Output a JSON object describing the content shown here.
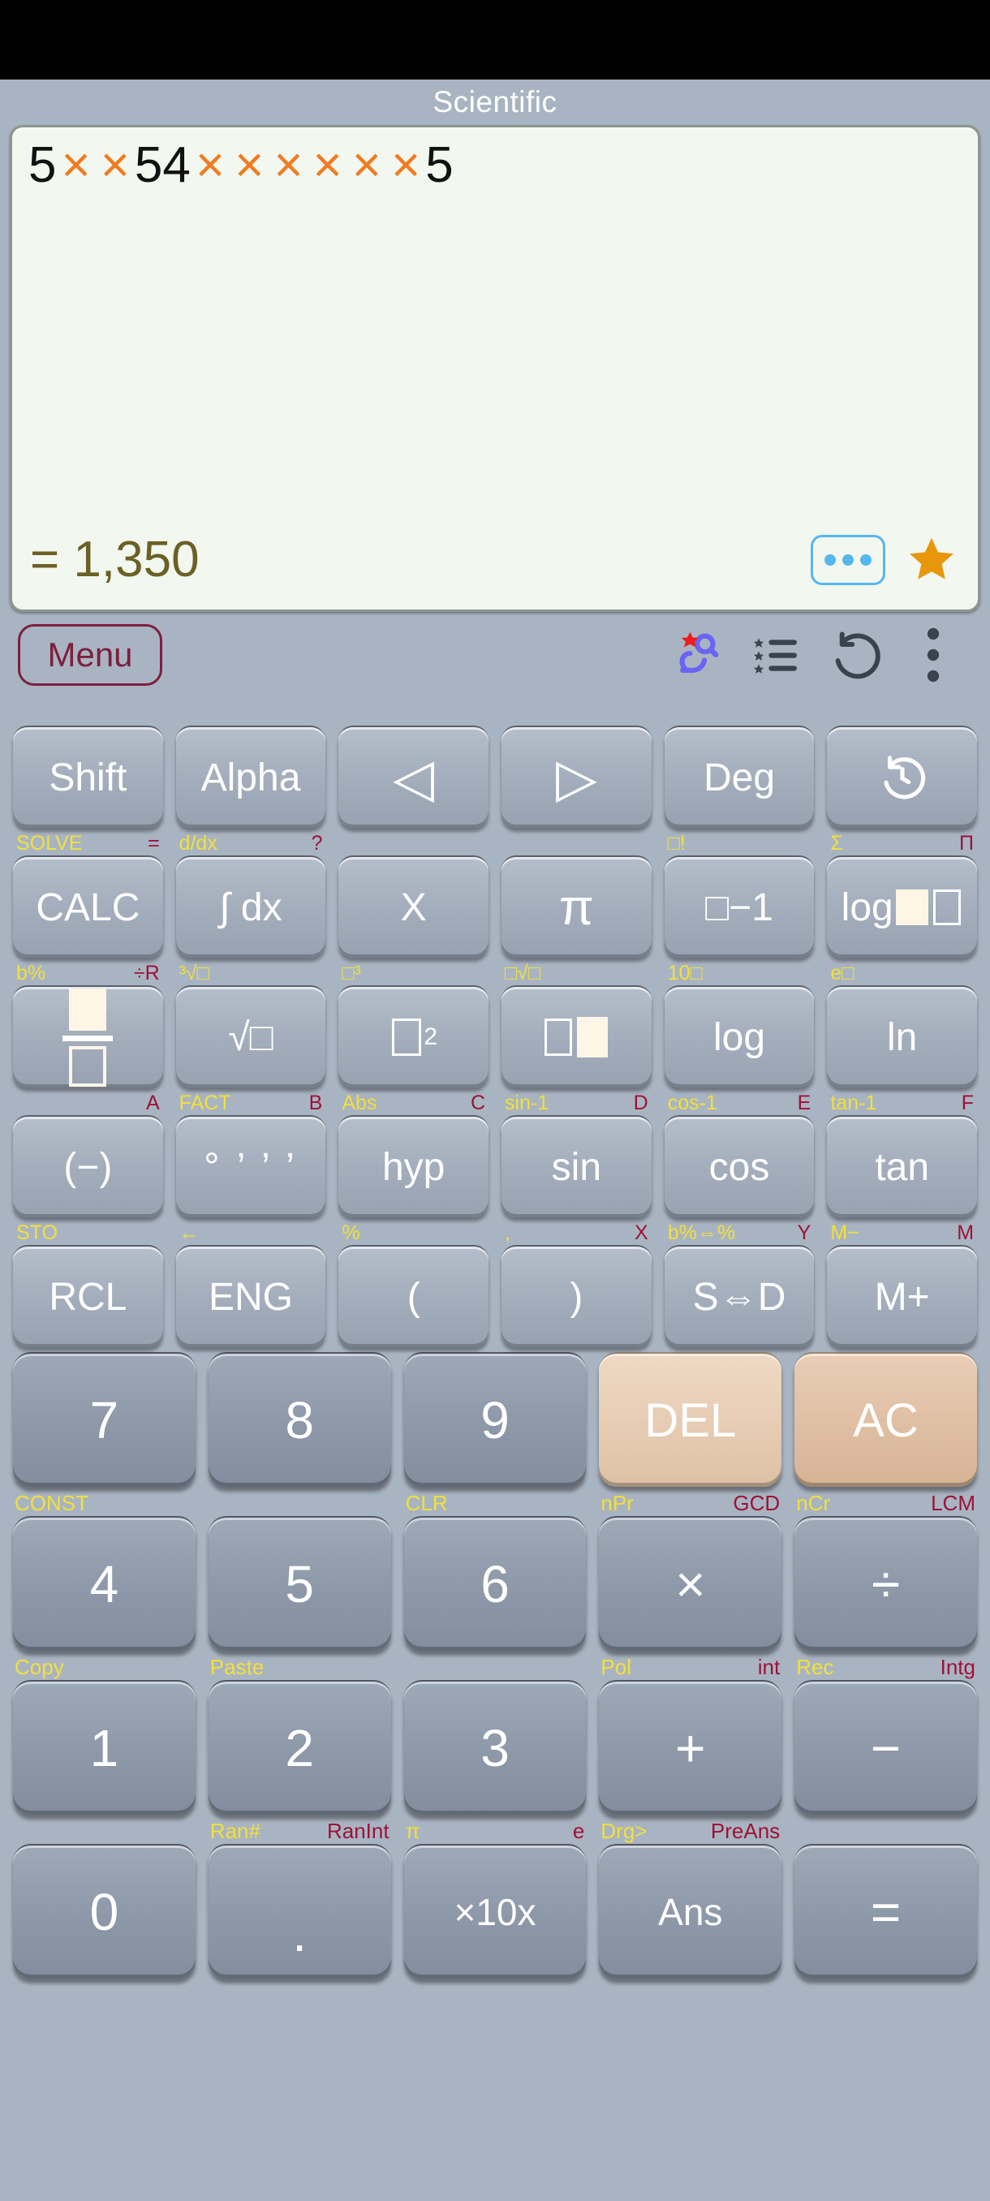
{
  "app": {
    "title": "Scientific"
  },
  "display": {
    "expression_tokens": [
      {
        "t": "5",
        "k": "num"
      },
      {
        "t": "×",
        "k": "op"
      },
      {
        "t": "×",
        "k": "op"
      },
      {
        "t": "54",
        "k": "num"
      },
      {
        "t": "×",
        "k": "op"
      },
      {
        "t": "×",
        "k": "op"
      },
      {
        "t": "×",
        "k": "op"
      },
      {
        "t": "×",
        "k": "op"
      },
      {
        "t": "×",
        "k": "op"
      },
      {
        "t": "×",
        "k": "op"
      },
      {
        "t": "5",
        "k": "num"
      }
    ],
    "expression_text": "5 × × 54 × × × × × × 5",
    "result": "= 1,350",
    "more_button": "…",
    "favorite_icon": "star-icon",
    "colors": {
      "screen_bg": "#f2f7ef",
      "operator": "#f07c21",
      "result_text": "#6b6025",
      "more_border": "#56b7ee",
      "star": "#e8960c"
    }
  },
  "toolbar": {
    "menu_label": "Menu",
    "icons": [
      {
        "name": "search-history-icon"
      },
      {
        "name": "favorites-list-icon"
      },
      {
        "name": "undo-icon"
      },
      {
        "name": "overflow-menu-icon"
      }
    ],
    "menu_color": "#7d1f3d"
  },
  "function_rows": [
    {
      "hints": [
        {
          "shift": "",
          "alpha": ""
        },
        {
          "shift": "",
          "alpha": ""
        },
        {
          "shift": "",
          "alpha": ""
        },
        {
          "shift": "",
          "alpha": ""
        },
        {
          "shift": "",
          "alpha": ""
        },
        {
          "shift": "",
          "alpha": ""
        }
      ],
      "keys": [
        {
          "label": "Shift",
          "name": "shift"
        },
        {
          "label": "Alpha",
          "name": "alpha"
        },
        {
          "label": "◁",
          "name": "arrow-left"
        },
        {
          "label": "▷",
          "name": "arrow-right"
        },
        {
          "label": "Deg",
          "name": "deg"
        },
        {
          "label": "",
          "name": "history",
          "icon": "history-icon"
        }
      ]
    },
    {
      "hints": [
        {
          "shift": "SOLVE",
          "alpha": "="
        },
        {
          "shift": "d/dx",
          "alpha": "?"
        },
        {
          "shift": "",
          "alpha": ""
        },
        {
          "shift": "",
          "alpha": ""
        },
        {
          "shift": "□!",
          "alpha": ""
        },
        {
          "shift": "Σ",
          "alpha": "Π"
        }
      ],
      "keys": [
        {
          "label": "CALC",
          "name": "calc"
        },
        {
          "label": "∫ dx",
          "name": "integral"
        },
        {
          "label": "X",
          "name": "variable-x"
        },
        {
          "label": "π",
          "name": "pi"
        },
        {
          "label": "□−1",
          "name": "reciprocal",
          "icon": "box-inverse"
        },
        {
          "label": "log□□",
          "name": "log-base",
          "icon": "log-base"
        }
      ]
    },
    {
      "hints": [
        {
          "shift": "b%",
          "alpha": "÷R"
        },
        {
          "shift": "³√□",
          "alpha": ""
        },
        {
          "shift": "□³",
          "alpha": ""
        },
        {
          "shift": "□√□",
          "alpha": ""
        },
        {
          "shift": "10□",
          "alpha": ""
        },
        {
          "shift": "e□",
          "alpha": ""
        }
      ],
      "keys": [
        {
          "label": "□/□",
          "name": "fraction",
          "icon": "fraction"
        },
        {
          "label": "√□",
          "name": "square-root",
          "icon": "sqrt"
        },
        {
          "label": "□²",
          "name": "square",
          "icon": "square"
        },
        {
          "label": "□□",
          "name": "power",
          "icon": "power"
        },
        {
          "label": "log",
          "name": "log"
        },
        {
          "label": "ln",
          "name": "ln"
        }
      ]
    },
    {
      "hints": [
        {
          "shift": "",
          "alpha": "A"
        },
        {
          "shift": "FACT",
          "alpha": "B"
        },
        {
          "shift": "Abs",
          "alpha": "C"
        },
        {
          "shift": "sin-1",
          "alpha": "D"
        },
        {
          "shift": "cos-1",
          "alpha": "E"
        },
        {
          "shift": "tan-1",
          "alpha": "F"
        }
      ],
      "keys": [
        {
          "label": "(−)",
          "name": "negative"
        },
        {
          "label": "° ’ ’ ’",
          "name": "degrees-minutes-seconds"
        },
        {
          "label": "hyp",
          "name": "hyp"
        },
        {
          "label": "sin",
          "name": "sin"
        },
        {
          "label": "cos",
          "name": "cos"
        },
        {
          "label": "tan",
          "name": "tan"
        }
      ]
    },
    {
      "hints": [
        {
          "shift": "STO",
          "alpha": ""
        },
        {
          "shift": "←",
          "alpha": ""
        },
        {
          "shift": "%",
          "alpha": ""
        },
        {
          "shift": ",",
          "alpha": "X"
        },
        {
          "shift": "b%⇔%",
          "alpha": "Y"
        },
        {
          "shift": "M−",
          "alpha": "M"
        }
      ],
      "keys": [
        {
          "label": "RCL",
          "name": "rcl"
        },
        {
          "label": "ENG",
          "name": "eng"
        },
        {
          "label": "(",
          "name": "paren-open"
        },
        {
          "label": ")",
          "name": "paren-close"
        },
        {
          "label": "S⇔D",
          "name": "s-to-d"
        },
        {
          "label": "M+",
          "name": "memory-plus"
        }
      ]
    }
  ],
  "numeric_rows": [
    {
      "keys": [
        {
          "label": "7",
          "name": "digit-7",
          "style": "num"
        },
        {
          "label": "8",
          "name": "digit-8",
          "style": "num"
        },
        {
          "label": "9",
          "name": "digit-9",
          "style": "num"
        },
        {
          "label": "DEL",
          "name": "delete",
          "style": "del"
        },
        {
          "label": "AC",
          "name": "all-clear",
          "style": "ac"
        }
      ],
      "hints_below": [
        {
          "shift": "CONST",
          "alpha": ""
        },
        {
          "shift": "",
          "alpha": ""
        },
        {
          "shift": "CLR",
          "alpha": ""
        },
        {
          "shift": "nPr",
          "alpha": "GCD"
        },
        {
          "shift": "nCr",
          "alpha": "LCM"
        }
      ]
    },
    {
      "keys": [
        {
          "label": "4",
          "name": "digit-4",
          "style": "num"
        },
        {
          "label": "5",
          "name": "digit-5",
          "style": "num"
        },
        {
          "label": "6",
          "name": "digit-6",
          "style": "num"
        },
        {
          "label": "×",
          "name": "multiply",
          "style": "num"
        },
        {
          "label": "÷",
          "name": "divide",
          "style": "num"
        }
      ],
      "hints_below": [
        {
          "shift": "Copy",
          "alpha": ""
        },
        {
          "shift": "Paste",
          "alpha": ""
        },
        {
          "shift": "",
          "alpha": ""
        },
        {
          "shift": "Pol",
          "alpha": "int"
        },
        {
          "shift": "Rec",
          "alpha": "Intg"
        }
      ]
    },
    {
      "keys": [
        {
          "label": "1",
          "name": "digit-1",
          "style": "num"
        },
        {
          "label": "2",
          "name": "digit-2",
          "style": "num"
        },
        {
          "label": "3",
          "name": "digit-3",
          "style": "num"
        },
        {
          "label": "+",
          "name": "plus",
          "style": "num"
        },
        {
          "label": "−",
          "name": "minus",
          "style": "num"
        }
      ],
      "hints_below": [
        {
          "shift": "",
          "alpha": ""
        },
        {
          "shift": "Ran#",
          "alpha": "RanInt"
        },
        {
          "shift": "π",
          "alpha": "e"
        },
        {
          "shift": "Drg>",
          "alpha": "PreAns"
        },
        {
          "shift": "",
          "alpha": ""
        }
      ]
    },
    {
      "keys": [
        {
          "label": "0",
          "name": "digit-0",
          "style": "num"
        },
        {
          "label": ".",
          "name": "decimal-point",
          "style": "num"
        },
        {
          "label": "×10x",
          "name": "times-ten-power",
          "style": "num"
        },
        {
          "label": "Ans",
          "name": "ans",
          "style": "num"
        },
        {
          "label": "=",
          "name": "equals",
          "style": "num"
        }
      ],
      "hints_below": []
    }
  ],
  "colors": {
    "background": "#a9b4c2",
    "key_face": "#a4aebc",
    "numkey_face": "#8e99a9",
    "del_key": "#e7cdb4",
    "ac_key": "#e0c0a5",
    "shift_label": "#f2e03a",
    "alpha_label": "#9d1236"
  }
}
